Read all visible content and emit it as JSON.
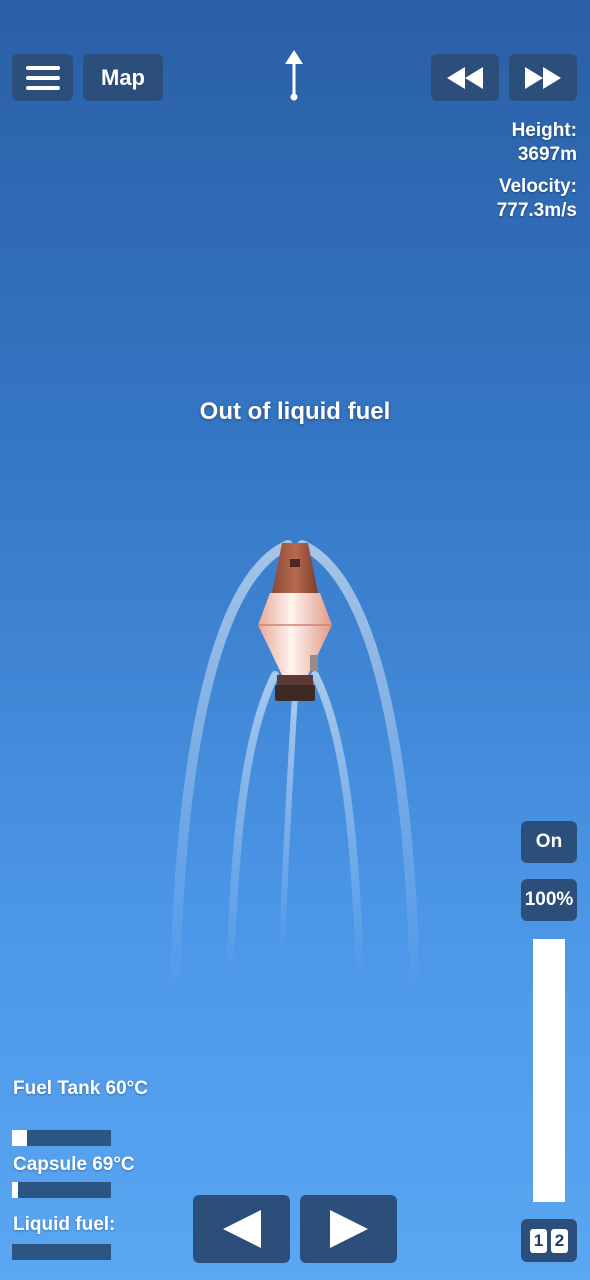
{
  "toolbar": {
    "menu_icon": "hamburger-menu-icon",
    "map_label": "Map",
    "rewind_icon": "rewind-icon",
    "fast_forward_icon": "fast-forward-icon"
  },
  "hud": {
    "height_label": "Height:",
    "height_value": "3697m",
    "velocity_label": "Velocity:",
    "velocity_value": "777.3m/s"
  },
  "message": "Out of liquid fuel",
  "controls": {
    "engine_toggle_label": "On",
    "throttle_label": "100%",
    "throttle_fraction": 1.0,
    "stage_digits": [
      "1",
      "2"
    ],
    "rotate_left_icon": "triangle-left-icon",
    "rotate_right_icon": "triangle-right-icon"
  },
  "parts": {
    "fuel_tank_label": "Fuel Tank 60°C",
    "fuel_tank_heat_fraction": 0.15,
    "capsule_label": "Capsule 69°C",
    "capsule_heat_fraction": 0.06,
    "liquid_fuel_label": "Liquid fuel:",
    "liquid_fuel_fraction": 0.0
  },
  "colors": {
    "button_bg": "#2b4e7a",
    "sky_top": "#2a5fa6",
    "sky_bottom": "#5aa7f3"
  }
}
